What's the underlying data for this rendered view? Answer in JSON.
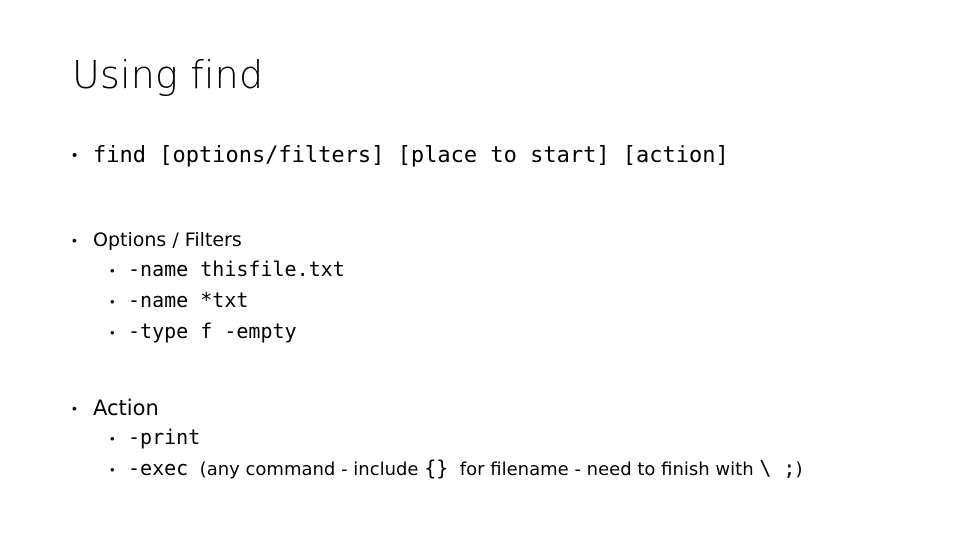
{
  "slide": {
    "title": "Using find",
    "bullet_glyph": "•",
    "colors": {
      "background": "#ffffff",
      "text": "#000000"
    },
    "syntax_line": {
      "text": "find [options/filters] [place to start] [action]"
    },
    "sections": [
      {
        "heading": "Options / Filters",
        "items": [
          {
            "code": "-name thisfile.txt"
          },
          {
            "code": "-name *txt"
          },
          {
            "code": "-type f -empty"
          }
        ]
      },
      {
        "heading": "Action",
        "items": [
          {
            "code": "-print"
          },
          {
            "code": "-exec",
            "note_a": "(any command - include",
            "code_braces": "{}",
            "note_b": "for filename - need to finish with",
            "code_end": "\\ ;",
            "note_c": ")"
          }
        ]
      }
    ]
  }
}
